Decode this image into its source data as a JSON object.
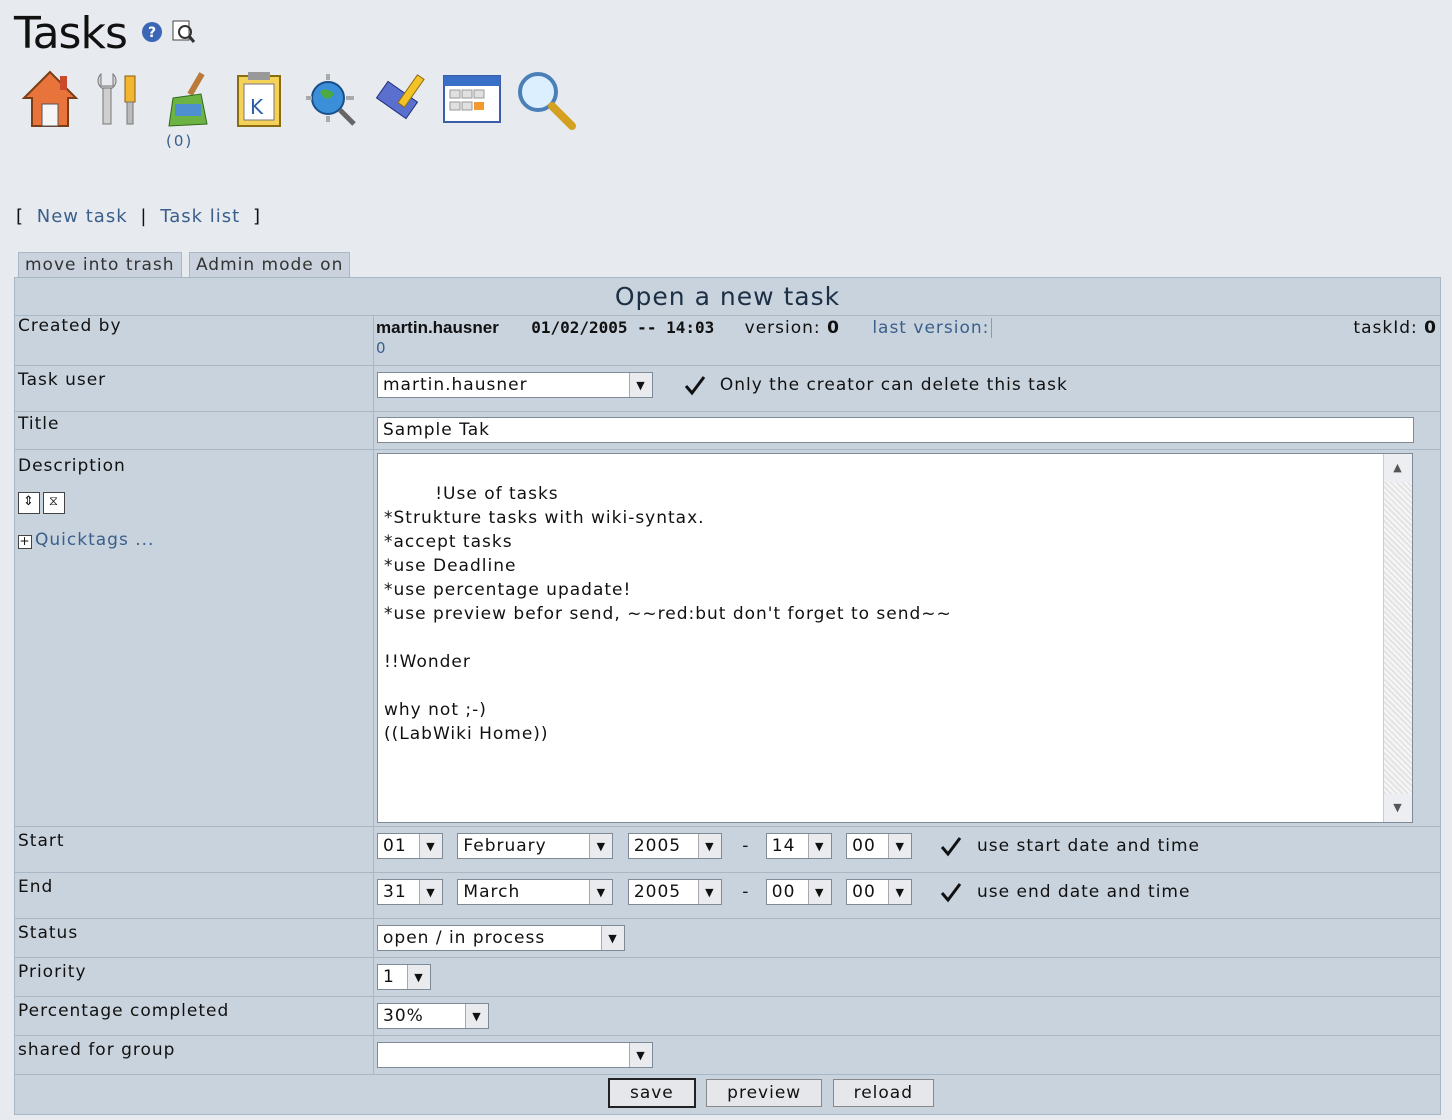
{
  "page": {
    "title": "Tasks"
  },
  "toolbar": {
    "counter": "(0)"
  },
  "nav": {
    "new_task": "New task",
    "task_list": "Task list",
    "open_bracket": "[",
    "separator": "|",
    "close_bracket": "]"
  },
  "tabs": [
    "move into trash",
    "Admin mode on"
  ],
  "form": {
    "heading": "Open a new task",
    "created_by": {
      "label": "Created by",
      "user": "martin.hausner",
      "datetime": "01/02/2005 -- 14:03",
      "version_label": "version:",
      "version": "0",
      "last_version_label": "last version:",
      "last_version_value": "0",
      "taskid_label": "taskId:",
      "taskid": "0"
    },
    "task_user": {
      "label": "Task user",
      "value": "martin.hausner",
      "creator_delete": "Only the creator can delete this task"
    },
    "title": {
      "label": "Title",
      "value": "Sample Tak"
    },
    "description": {
      "label": "Description",
      "quicktags": "Quicktags ...",
      "text": "!Use of tasks\n*Strukture tasks with wiki-syntax.\n*accept tasks\n*use Deadline\n*use percentage upadate!\n*use preview befor send, ~~red:but don't forget to send~~\n\n!!Wonder\n\nwhy not ;-)\n((LabWiki Home))"
    },
    "start": {
      "label": "Start",
      "day": "01",
      "month": "February",
      "year": "2005",
      "dash": "-",
      "hour": "14",
      "minute": "00",
      "use_label": "use start date and time"
    },
    "end": {
      "label": "End",
      "day": "31",
      "month": "March",
      "year": "2005",
      "dash": "-",
      "hour": "00",
      "minute": "00",
      "use_label": "use end date and time"
    },
    "status": {
      "label": "Status",
      "value": "open / in process"
    },
    "priority": {
      "label": "Priority",
      "value": "1"
    },
    "percentage": {
      "label": "Percentage completed",
      "value": "30%"
    },
    "group": {
      "label": "shared for group",
      "value": ""
    },
    "buttons": {
      "save": "save",
      "preview": "preview",
      "reload": "reload"
    }
  }
}
